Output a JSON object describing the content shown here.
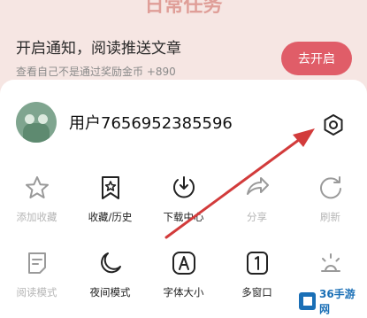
{
  "background": {
    "title": "日常任务",
    "task_text": "开启通知，阅读推送文章",
    "task_sub": "查看自己不是通过奖励金币 +890",
    "button_label": "去开启"
  },
  "user": {
    "name": "用户7656952385596"
  },
  "settings": {
    "icon": "gear-icon"
  },
  "menu_row1": [
    {
      "label": "添加收藏",
      "icon": "star-icon",
      "enabled": false
    },
    {
      "label": "收藏/历史",
      "icon": "star-badge-icon",
      "enabled": true
    },
    {
      "label": "下载中心",
      "icon": "download-icon",
      "enabled": true
    },
    {
      "label": "分享",
      "icon": "share-icon",
      "enabled": false
    },
    {
      "label": "刷新",
      "icon": "refresh-icon",
      "enabled": false
    }
  ],
  "menu_row2": [
    {
      "label": "阅读模式",
      "icon": "reader-icon",
      "enabled": false
    },
    {
      "label": "夜间模式",
      "icon": "moon-icon",
      "enabled": true
    },
    {
      "label": "字体大小",
      "icon": "font-size-icon",
      "enabled": true
    },
    {
      "label": "多窗口",
      "icon": "window-icon",
      "enabled": true
    },
    {
      "label": "",
      "icon": "sunset-icon",
      "enabled": false
    }
  ],
  "watermark": {
    "text": "36手游网"
  },
  "colors": {
    "accent": "#e05d68",
    "arrow": "#d23b3b",
    "watermark": "#1a6fb6"
  }
}
